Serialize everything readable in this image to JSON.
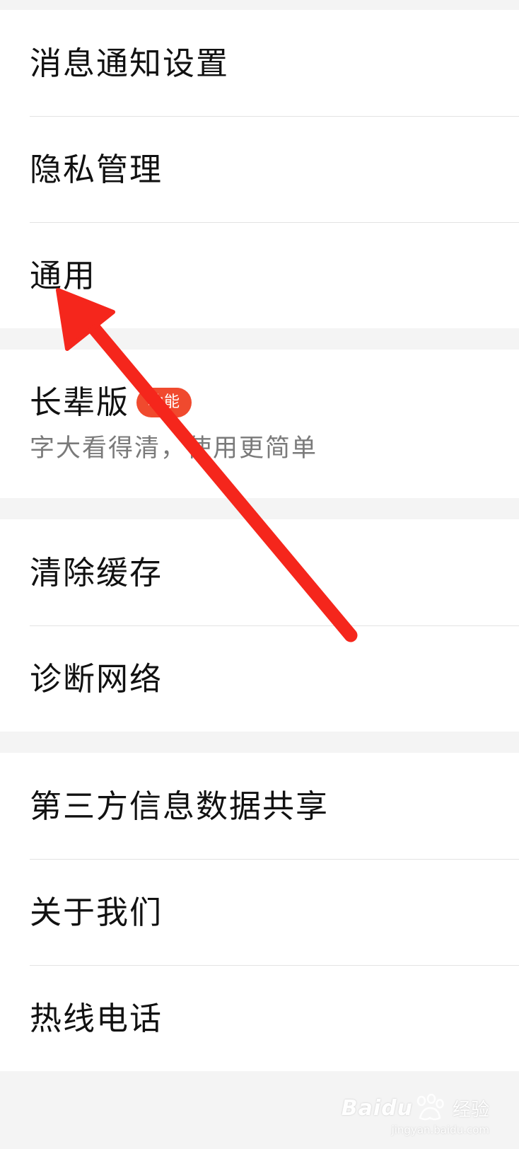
{
  "settings": {
    "group1": [
      {
        "label": "消息通知设置"
      },
      {
        "label": "隐私管理"
      },
      {
        "label": "通用"
      }
    ],
    "elder_mode": {
      "label": "长辈版",
      "badge": "功能",
      "subtitle": "字大看得清，使用更简单"
    },
    "group3": [
      {
        "label": "清除缓存"
      },
      {
        "label": "诊断网络"
      }
    ],
    "group4": [
      {
        "label": "第三方信息数据共享"
      },
      {
        "label": "关于我们"
      },
      {
        "label": "热线电话"
      }
    ]
  },
  "annotation": {
    "color": "#f5261c",
    "icon": "red-arrow-icon"
  },
  "watermark": {
    "brand": "Baidu",
    "cn": "经验",
    "url": "jingyan.baidu.com"
  },
  "colors": {
    "background": "#f4f4f4",
    "card": "#ffffff",
    "text": "#111111",
    "subtext": "#7a7a7a",
    "badge": "#f04a2e"
  }
}
